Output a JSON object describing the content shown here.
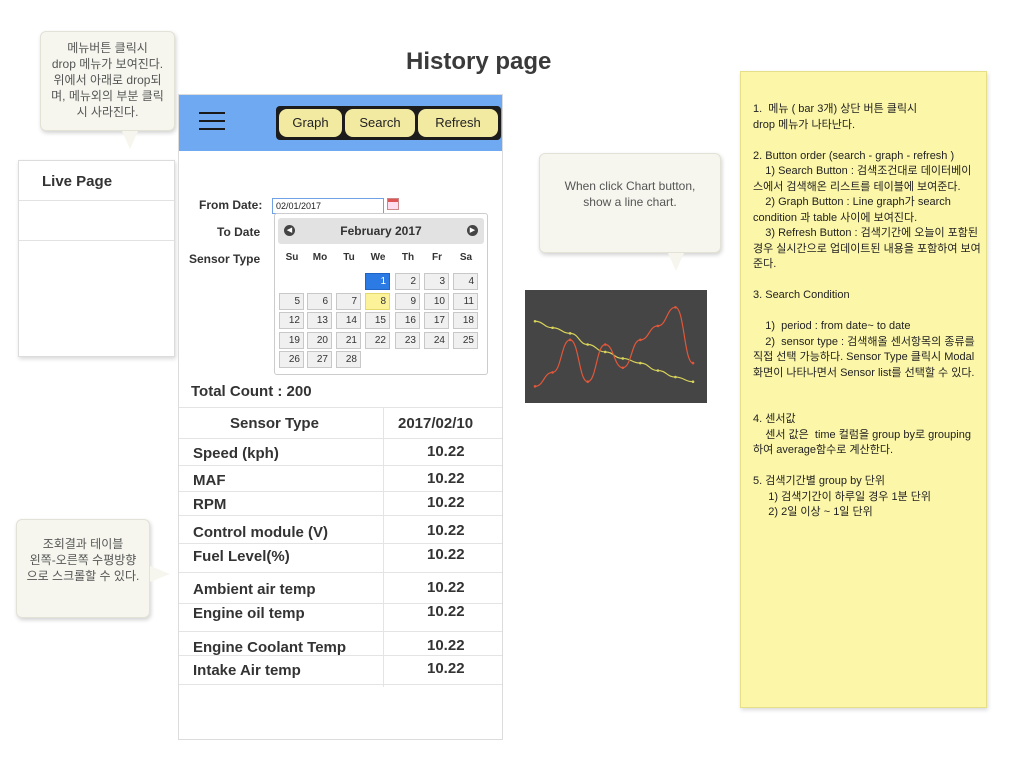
{
  "page": {
    "title": "History page"
  },
  "callouts": {
    "menu": "메뉴버튼 클릭시\ndrop 메뉴가 보여진다.\n위에서 아래로 drop되\n며, 메뉴외의 부분 클릭\n시 사라진다.",
    "chart": "When click Chart button,\nshow a line chart.",
    "scroll": "조회결과 테이블\n왼쪽-오른쪽 수평방향\n으로 스크롤할 수 있다."
  },
  "menu": {
    "items": [
      "Live Page",
      "",
      ""
    ]
  },
  "toolbar": {
    "menu_icon": "hamburger-icon",
    "buttons": {
      "graph": "Graph",
      "search": "Search",
      "refresh": "Refresh"
    },
    "color": "#6fa9f1",
    "button_color": "#f3eaa2"
  },
  "form": {
    "from_label": "From  Date:",
    "from_value": "02/01/2017",
    "to_label": "To Date",
    "sensor_label": "Sensor Type"
  },
  "calendar": {
    "title": "February 2017",
    "prev": "◀",
    "next": "▶",
    "dow": [
      "Su",
      "Mo",
      "Tu",
      "We",
      "Th",
      "Fr",
      "Sa"
    ],
    "first_weekday": 3,
    "days": 28,
    "selected_day": 1,
    "today_day": 8
  },
  "results": {
    "total": "Total Count : 200",
    "header_type": "Sensor Type",
    "header_date": "2017/02/10",
    "rows": [
      {
        "name": "Speed (kph)",
        "value": "10.22"
      },
      {
        "name": "MAF",
        "value": "10.22"
      },
      {
        "name": "RPM",
        "value": "10.22"
      },
      {
        "name": "Control module (V)",
        "value": "10.22"
      },
      {
        "name": "Fuel Level(%)",
        "value": "10.22"
      },
      {
        "name": "Ambient air temp",
        "value": "10.22"
      },
      {
        "name": "Engine oil temp",
        "value": "10.22"
      },
      {
        "name": "Engine Coolant Temp",
        "value": "10.22"
      },
      {
        "name": "Intake Air temp",
        "value": "10.22"
      }
    ]
  },
  "chart": {
    "background": "#454545",
    "series": [
      {
        "color": "#d9d35a",
        "values": [
          0.75,
          0.68,
          0.62,
          0.5,
          0.42,
          0.35,
          0.3,
          0.22,
          0.15,
          0.1
        ]
      },
      {
        "color": "#e0573a",
        "values": [
          0.05,
          0.2,
          0.55,
          0.1,
          0.5,
          0.25,
          0.55,
          0.7,
          0.9,
          0.3
        ]
      }
    ]
  },
  "note": {
    "text": "1.  메뉴 ( bar 3개) 상단 버튼 클릭시\ndrop 메뉴가 나타난다.\n\n2. Button order (search - graph - refresh )\n    1) Search Button : 검색조건대로 데이터베이스에서 검색해온 리스트를 테이블에 보여준다.\n    2) Graph Button : Line graph가 search condition 과 table 사이에 보여진다.\n    3) Refresh Button : 검색기간에 오늘이 포함된 경우 실시간으로 업데이트된 내용을 포함하여 보여준다.\n\n3. Search Condition\n\n    1)  period : from date~ to date\n    2)  sensor type : 검색해올 센서항목의 종류를 직접 선택 가능하다. Sensor Type 클릭시 Modal 화면이 나타나면서 Sensor list를 선택할 수 있다.\n\n\n4. 센서값\n    센서 값은  time 컬럼을 group by로 grouping 하여 average함수로 계산한다.\n\n5. 검색기간별 group by 단위\n     1) 검색기간이 하루일 경우 1분 단위\n     2) 2일 이상 ~ 1일 단위"
  }
}
